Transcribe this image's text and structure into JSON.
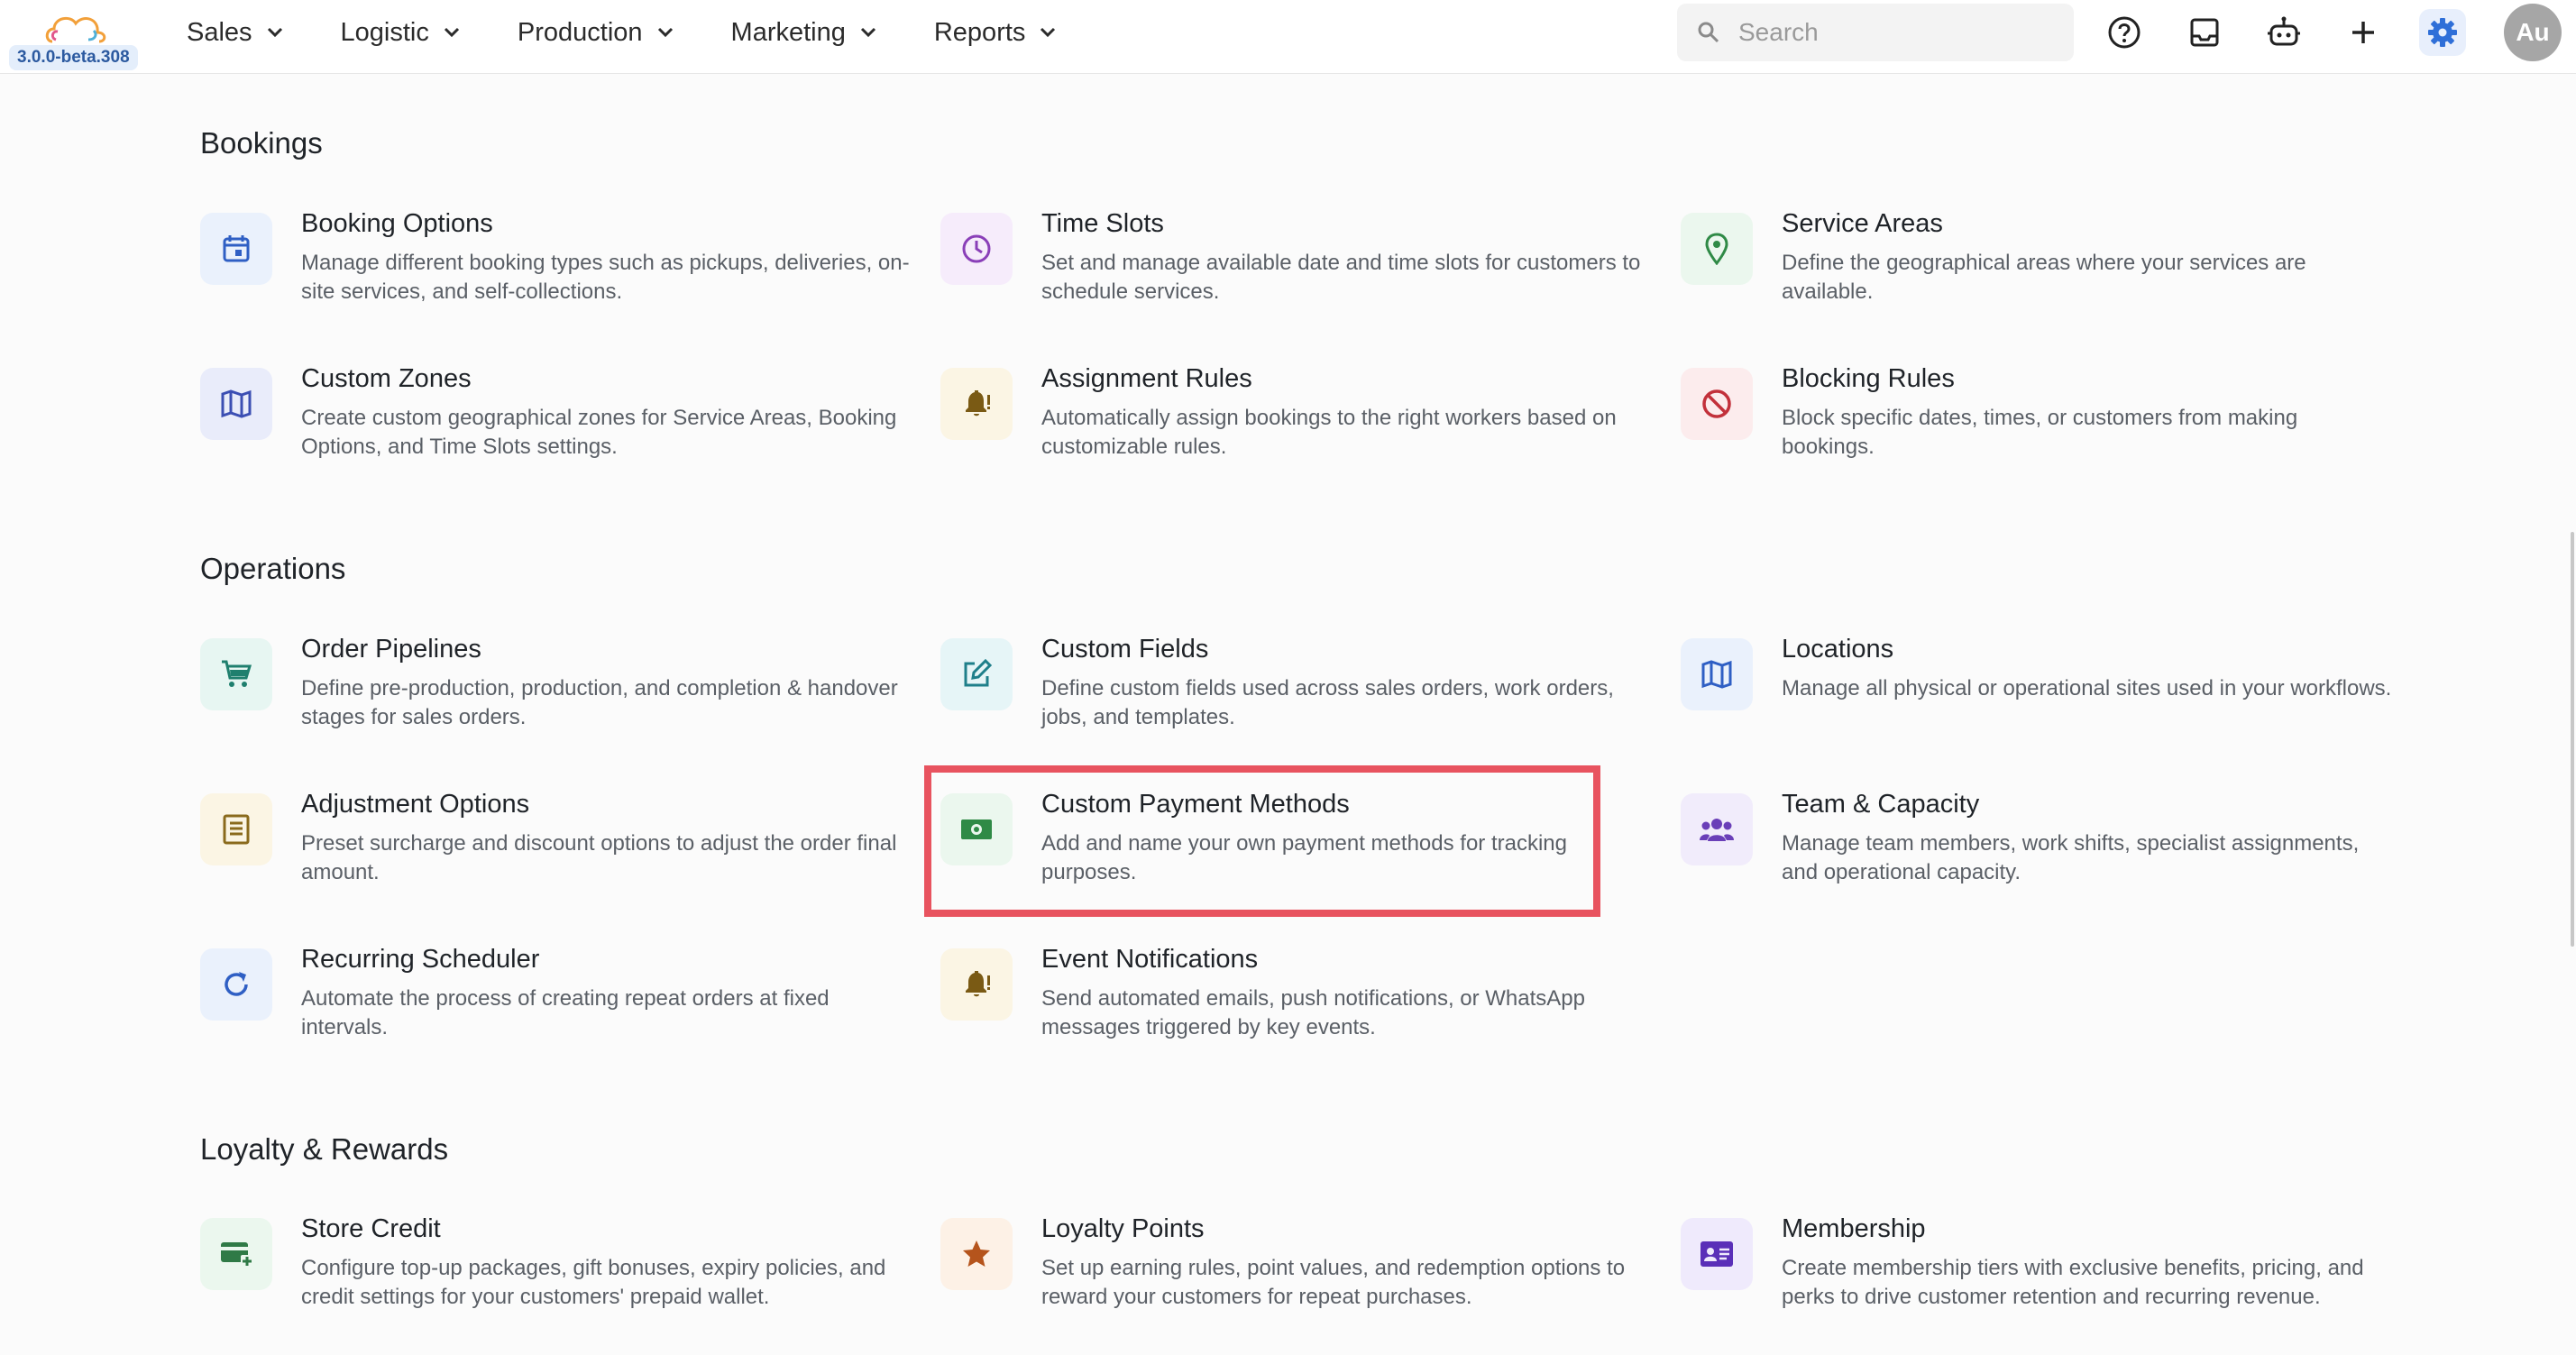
{
  "app": {
    "version": "3.0.0-beta.308"
  },
  "nav": {
    "items": [
      "Sales",
      "Logistic",
      "Production",
      "Marketing",
      "Reports"
    ]
  },
  "search": {
    "placeholder": "Search"
  },
  "user": {
    "initials": "Au"
  },
  "colors": {
    "accent": "#2f6fd8",
    "highlight": "#e8535f"
  },
  "sections": [
    {
      "title": "Bookings",
      "items": [
        {
          "title": "Booking Options",
          "desc": "Manage different booking types such as pickups, deliveries, on-site services, and self-collections.",
          "icon": "calendar-icon",
          "color": "#2f5fc4",
          "bg": "#eaf1fc"
        },
        {
          "title": "Time Slots",
          "desc": "Set and manage available date and time slots for customers to schedule services.",
          "icon": "clock-icon",
          "color": "#8a3fb8",
          "bg": "#f6ecfb"
        },
        {
          "title": "Service Areas",
          "desc": "Define the geographical areas where your services are available.",
          "icon": "location-pin-icon",
          "color": "#2f8a46",
          "bg": "#ebf7ee"
        },
        {
          "title": "Custom Zones",
          "desc": "Create custom geographical zones for Service Areas, Booking Options, and Time Slots settings.",
          "icon": "map-icon",
          "color": "#3c4fb3",
          "bg": "#e9ecfa"
        },
        {
          "title": "Assignment Rules",
          "desc": "Automatically assign bookings to the right workers based on customizable rules.",
          "icon": "bell-alert-icon",
          "color": "#7a5a14",
          "bg": "#fbf5e4"
        },
        {
          "title": "Blocking Rules",
          "desc": "Block specific dates, times, or customers from making bookings.",
          "icon": "block-icon",
          "color": "#c2313b",
          "bg": "#fceced"
        }
      ]
    },
    {
      "title": "Operations",
      "items": [
        {
          "title": "Order Pipelines",
          "desc": "Define pre-production, production, and completion & handover stages for sales orders.",
          "icon": "cart-icon",
          "color": "#1f7f6e",
          "bg": "#e7f6f2"
        },
        {
          "title": "Custom Fields",
          "desc": "Define custom fields used across sales orders, work orders, jobs, and templates.",
          "icon": "edit-icon",
          "color": "#1f7f8a",
          "bg": "#e6f5f7"
        },
        {
          "title": "Locations",
          "desc": "Manage all physical or operational sites used in your workflows.",
          "icon": "map-icon",
          "color": "#2f5fc4",
          "bg": "#eaf1fc"
        },
        {
          "title": "Adjustment Options",
          "desc": "Preset surcharge and discount options to adjust the order final amount.",
          "icon": "receipt-icon",
          "color": "#8a6a1c",
          "bg": "#fbf5e4"
        },
        {
          "title": "Custom Payment Methods",
          "desc": "Add and name your own payment methods for tracking purposes.",
          "icon": "cash-icon",
          "color": "#2f8a46",
          "bg": "#ebf7ee"
        },
        {
          "title": "Team & Capacity",
          "desc": "Manage team members, work shifts, specialist assignments, and operational capacity.",
          "icon": "group-icon",
          "color": "#6a3fb8",
          "bg": "#f1ecfb"
        },
        {
          "title": "Recurring Scheduler",
          "desc": "Automate the process of creating repeat orders at fixed intervals.",
          "icon": "refresh-icon",
          "color": "#2f5fc4",
          "bg": "#eaf1fc"
        },
        {
          "title": "Event Notifications",
          "desc": "Send automated emails, push notifications, or WhatsApp messages triggered by key events.",
          "icon": "bell-alert-icon",
          "color": "#7a5a14",
          "bg": "#fbf5e4"
        }
      ]
    },
    {
      "title": "Loyalty & Rewards",
      "items": [
        {
          "title": "Store Credit",
          "desc": "Configure top-up packages, gift bonuses, expiry policies, and credit settings for your customers' prepaid wallet.",
          "icon": "credit-card-plus-icon",
          "color": "#2f7a46",
          "bg": "#ebf7ee"
        },
        {
          "title": "Loyalty Points",
          "desc": "Set up earning rules, point values, and redemption options to reward your customers for repeat purchases.",
          "icon": "star-icon",
          "color": "#b5541c",
          "bg": "#fdf1e6"
        },
        {
          "title": "Membership",
          "desc": "Create membership tiers with exclusive benefits, pricing, and perks to drive customer retention and recurring revenue.",
          "icon": "id-card-icon",
          "color": "#5a2fb8",
          "bg": "#efeafc"
        }
      ]
    }
  ]
}
